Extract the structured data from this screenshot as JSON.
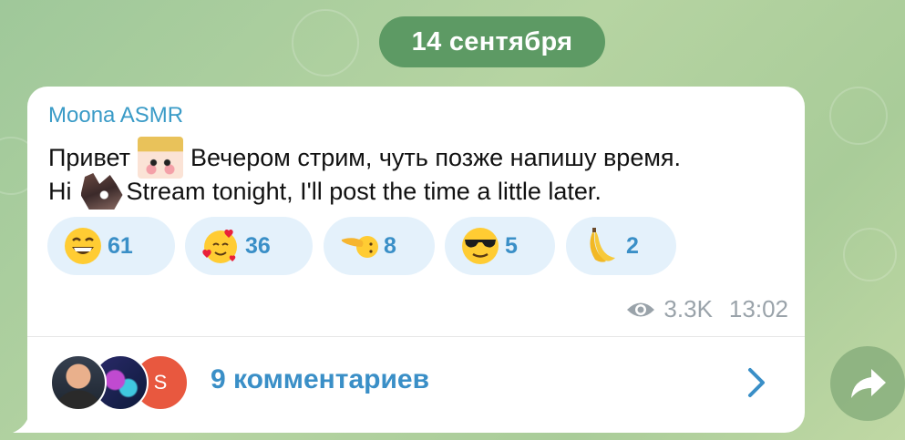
{
  "date_header": "14 сентября",
  "message": {
    "author": "Moona ASMR",
    "line1_before": "Привет",
    "line1_after": "Вечером стрим, чуть позже напишу время.",
    "line2_before": "Hi",
    "line2_after": "Stream tonight, I'll post the time a little later.",
    "stickers": [
      "anime-girl-sticker",
      "wolf-sticker"
    ]
  },
  "reactions": [
    {
      "icon": "grinning-face-emoji",
      "count": "61"
    },
    {
      "icon": "smiling-face-with-hearts-emoji",
      "count": "36"
    },
    {
      "icon": "pointing-hand-emoji",
      "count": "8"
    },
    {
      "icon": "sunglasses-face-emoji",
      "count": "5"
    },
    {
      "icon": "banana-emoji",
      "count": "2"
    }
  ],
  "meta": {
    "views": "3.3K",
    "time": "13:02"
  },
  "comments": {
    "avatar_letter": "S",
    "label": "9 комментариев"
  },
  "colors": {
    "accent": "#3a8fc7",
    "author": "#3a9bc7",
    "reaction_bg": "#e4f1fb",
    "date_pill": "#5d9a64"
  }
}
